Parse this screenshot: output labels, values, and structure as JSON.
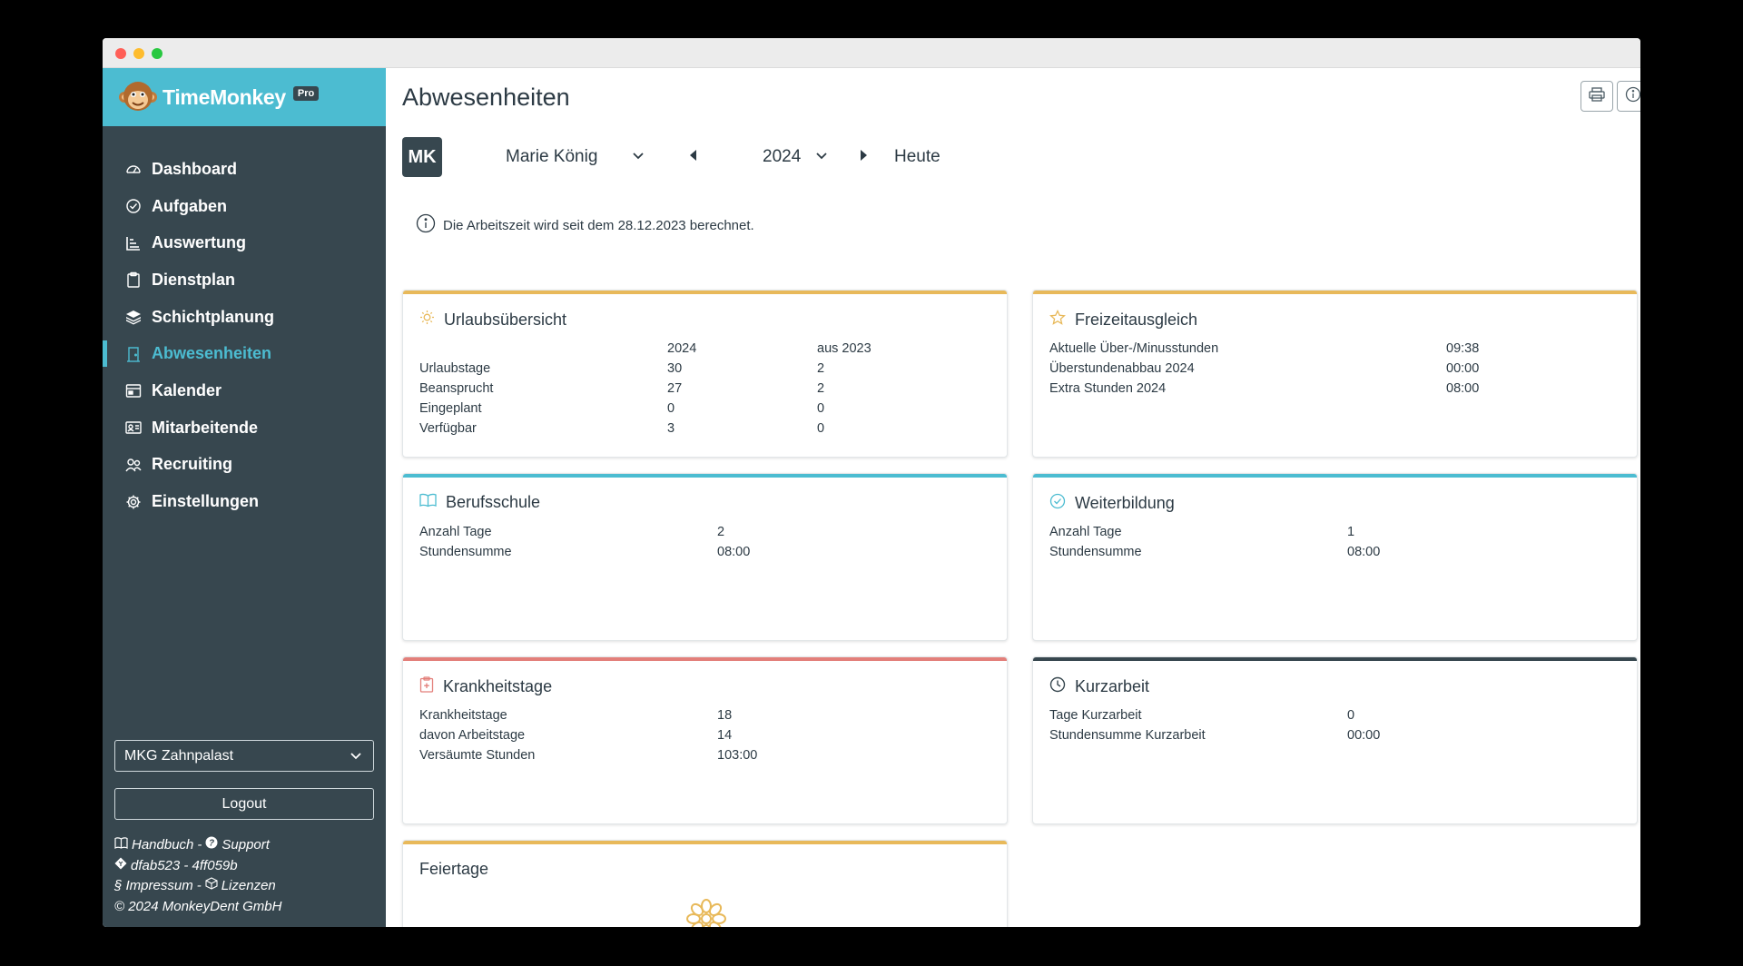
{
  "brand": {
    "name": "TimeMonkey",
    "badge": "Pro"
  },
  "sidebar": {
    "items": [
      {
        "label": "Dashboard",
        "icon": "dashboard-icon"
      },
      {
        "label": "Aufgaben",
        "icon": "check-circle-icon"
      },
      {
        "label": "Auswertung",
        "icon": "bar-list-icon"
      },
      {
        "label": "Dienstplan",
        "icon": "clipboard-icon"
      },
      {
        "label": "Schichtplanung",
        "icon": "layers-icon"
      },
      {
        "label": "Abwesenheiten",
        "icon": "door-icon",
        "active": true
      },
      {
        "label": "Kalender",
        "icon": "calendar-icon"
      },
      {
        "label": "Mitarbeitende",
        "icon": "id-card-icon"
      },
      {
        "label": "Recruiting",
        "icon": "people-icon"
      },
      {
        "label": "Einstellungen",
        "icon": "gear-icon"
      }
    ],
    "practice_select": "MKG Zahnpalast",
    "logout_label": "Logout",
    "footer": {
      "handbook": "Handbuch",
      "support": "Support",
      "version": "dfab523 - 4ff059b",
      "impressum": "§ Impressum",
      "licenses": "Lizenzen",
      "copyright": "© 2024 MonkeyDent GmbH"
    }
  },
  "header": {
    "title": "Abwesenheiten",
    "avatar_initials": "MK",
    "employee": "Marie König",
    "year": "2024",
    "today_label": "Heute",
    "info_text": "Die Arbeitszeit wird seit dem 28.12.2023 berechnet."
  },
  "colors": {
    "accent_teal": "#4cbcd1",
    "accent_gold": "#e8b95a",
    "accent_red": "#e37f7a",
    "accent_dark": "#37474f"
  },
  "cards": {
    "urlaub": {
      "title": "Urlaubsübersicht",
      "col_a": "2024",
      "col_b": "aus 2023",
      "rows": [
        {
          "label": "Urlaubstage",
          "a": "30",
          "b": "2"
        },
        {
          "label": "Beansprucht",
          "a": "27",
          "b": "2"
        },
        {
          "label": "Eingeplant",
          "a": "0",
          "b": "0"
        },
        {
          "label": "Verfügbar",
          "a": "3",
          "b": "0"
        }
      ]
    },
    "freizeit": {
      "title": "Freizeitausgleich",
      "rows": [
        {
          "label": "Aktuelle Über-/Minusstunden",
          "value": "09:38"
        },
        {
          "label": "Überstundenabbau 2024",
          "value": "00:00"
        },
        {
          "label": "Extra Stunden 2024",
          "value": "08:00"
        }
      ]
    },
    "berufsschule": {
      "title": "Berufsschule",
      "rows": [
        {
          "label": "Anzahl Tage",
          "value": "2"
        },
        {
          "label": "Stundensumme",
          "value": "08:00"
        }
      ]
    },
    "weiterbildung": {
      "title": "Weiterbildung",
      "rows": [
        {
          "label": "Anzahl Tage",
          "value": "1"
        },
        {
          "label": "Stundensumme",
          "value": "08:00"
        }
      ]
    },
    "krankheit": {
      "title": "Krankheitstage",
      "rows": [
        {
          "label": "Krankheitstage",
          "value": "18"
        },
        {
          "label": "davon Arbeitstage",
          "value": "14"
        },
        {
          "label": "Versäumte Stunden",
          "value": "103:00"
        }
      ]
    },
    "kurzarbeit": {
      "title": "Kurzarbeit",
      "rows": [
        {
          "label": "Tage Kurzarbeit",
          "value": "0"
        },
        {
          "label": "Stundensumme Kurzarbeit",
          "value": "00:00"
        }
      ]
    },
    "feiertage": {
      "title": "Feiertage"
    }
  }
}
